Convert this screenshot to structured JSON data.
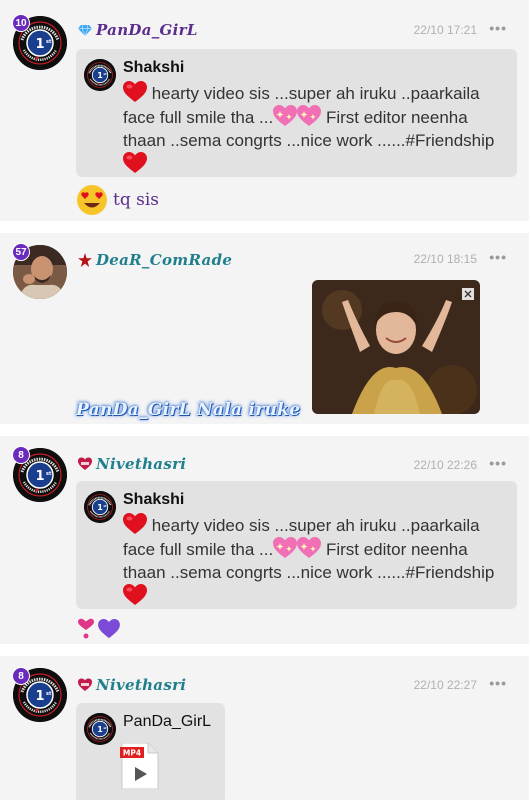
{
  "colors": {
    "level_badge": "#6a2bbd",
    "username_purple": "#5b2d8c",
    "username_teal": "#1f7f8c",
    "timestamp": "#b0b0b0",
    "quote_bg": "#e2e2e2",
    "heart_red": "#e0101e"
  },
  "messages": [
    {
      "level": "10",
      "avatar_icon": "tamil-heart-chat-1st-logo",
      "badge_icon": "diamond-icon",
      "username": "PanDa_GirL",
      "timestamp": "22/10 17:21",
      "more": "•••",
      "quote": {
        "author": "Shakshi",
        "avatar_icon": "tamil-heart-chat-1st-logo",
        "text_1": " hearty video sis ...super ah iruku ..paarkaila face full smile tha ...",
        "text_2": " First editor neenha thaan ..sema congrts ...nice work ......#Friendship "
      },
      "reply_icon": "heart-eyes-emoji-icon",
      "reply_text": "tq sis"
    },
    {
      "level": "57",
      "avatar_icon": "user-photo-avatar",
      "badge_icon": "star-badge-icon",
      "username": "DeaR_ComRade",
      "timestamp": "22/10 18:15",
      "more": "•••",
      "media_icon": "gif-image-thumbnail",
      "overlay_text": "PanDa_GirL Nala iruke"
    },
    {
      "level": "8",
      "avatar_icon": "tamil-heart-chat-1st-logo",
      "badge_icon": "heart-badge-icon",
      "username": "Nivethasri",
      "timestamp": "22/10 22:26",
      "more": "•••",
      "quote": {
        "author": "Shakshi",
        "avatar_icon": "tamil-heart-chat-1st-logo",
        "text_1": " hearty video sis ...super ah iruku ..paarkaila face full smile tha ...",
        "text_2": " First editor neenha thaan ..sema congrts ...nice work ......#Friendship "
      },
      "reply_icons": [
        "heart-exclamation-icon",
        "purple-heart-icon"
      ]
    },
    {
      "level": "8",
      "avatar_icon": "tamil-heart-chat-1st-logo",
      "badge_icon": "heart-badge-icon",
      "username": "Nivethasri",
      "timestamp": "22/10 22:27",
      "more": "•••",
      "quote": {
        "author": "PanDa_GirL",
        "avatar_icon": "tamil-heart-chat-1st-logo",
        "file_type": "MP4",
        "file_icon": "mp4-video-file-icon"
      }
    }
  ]
}
